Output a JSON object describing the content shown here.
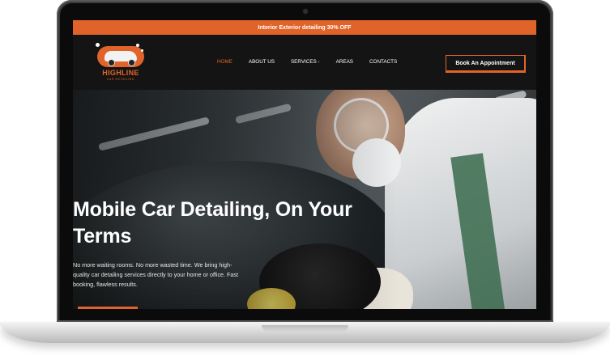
{
  "promo": {
    "text": "Interior Exterior detailing 30% OFF"
  },
  "brand": {
    "name": "HIGHLINE",
    "tagline": "CAR DETAILING"
  },
  "nav": {
    "items": [
      {
        "label": "HOME",
        "active": true
      },
      {
        "label": "ABOUT US",
        "active": false
      },
      {
        "label": "SERVICES",
        "active": false,
        "dropdown_caret": "+"
      },
      {
        "label": "AREAS",
        "active": false
      },
      {
        "label": "CONTACTS",
        "active": false
      }
    ],
    "cta_label": "Book An Appointment"
  },
  "hero": {
    "title": "Mobile Car Detailing, On Your Terms",
    "text": "No more waiting rooms. No more wasted time. We bring high-quality car detailing services directly to your home or office. Fast booking, flawless results."
  },
  "colors": {
    "accent": "#e0642a",
    "header_bg": "#141414",
    "text": "#ffffff"
  },
  "icons": {
    "dropdown": "plus-icon",
    "camera": "camera-icon"
  }
}
